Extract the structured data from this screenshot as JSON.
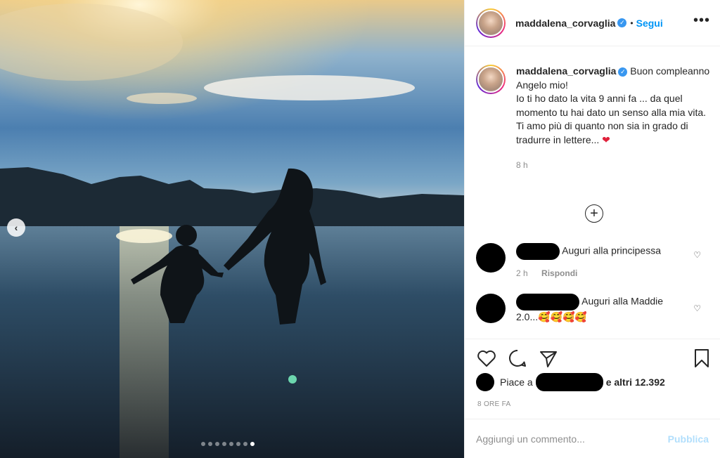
{
  "post": {
    "username": "maddalena_corvaglia",
    "verified": true,
    "follow_label": "Segui",
    "separator": "•",
    "more_icon": "more-dots-icon",
    "caption_first": "Buon compleanno Angelo mio!",
    "caption_rest": "Io ti ho dato la vita 9 anni fa ... da quel momento tu hai dato un senso alla mia vita.\nTi amo più di quanto non sia in grado di tradurre in lettere...",
    "caption_emoji": "❤",
    "caption_time": "8 h",
    "likes_prefix": "Piace a",
    "likes_suffix": "e altri 12.392",
    "posted_ago": "8 ORE FA"
  },
  "comments": [
    {
      "text": "Auguri alla principessa",
      "time": "2 h",
      "reply": "Rispondi"
    },
    {
      "text": "Auguri alla Maddie 2.0...🥰🥰🥰🥰"
    }
  ],
  "composer": {
    "placeholder": "Aggiungi un commento...",
    "publish_label": "Pubblica"
  },
  "carousel": {
    "total": 8,
    "active_index": 7
  },
  "colors": {
    "accent": "#0095f6",
    "muted": "#8e8e8e",
    "text": "#262626",
    "heart": "#e0213b"
  }
}
